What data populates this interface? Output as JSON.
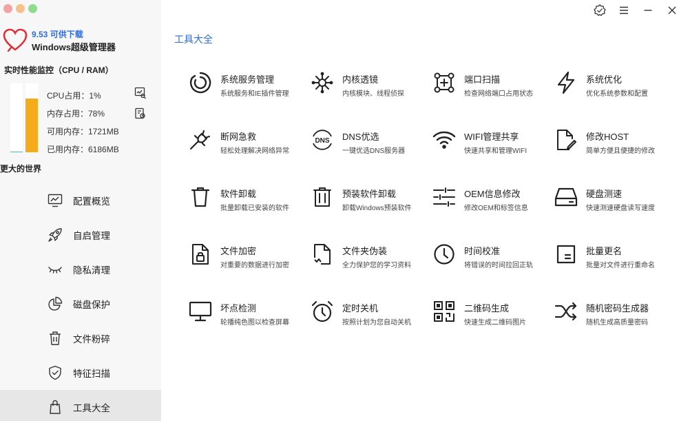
{
  "sidebar": {
    "update_text": "9.53 可供下载",
    "app_name": "Windows超级管理器",
    "monitor_title": "实时性能监控（CPU / RAM）",
    "cpu_usage_label": "CPU占用：1%",
    "mem_usage_label": "内存占用：78%",
    "available_mem_label": "可用内存：1721MB",
    "used_mem_label": "已用内存：6186MB",
    "cpu_percent": 1,
    "mem_percent": 78,
    "slogan": "更大的世界",
    "nav": [
      {
        "label": "配置概览",
        "icon": "monitor-chart-icon"
      },
      {
        "label": "自启管理",
        "icon": "rocket-icon"
      },
      {
        "label": "隐私清理",
        "icon": "eye-closed-icon"
      },
      {
        "label": "磁盘保护",
        "icon": "pie-chart-icon"
      },
      {
        "label": "文件粉碎",
        "icon": "trash-icon"
      },
      {
        "label": "特征扫描",
        "icon": "shield-check-icon"
      },
      {
        "label": "工具大全",
        "icon": "bag-icon",
        "active": true
      }
    ]
  },
  "main": {
    "title": "工具大全",
    "tools": [
      {
        "name": "系统服务管理",
        "desc": "系统服务和IE插件管理",
        "icon": "service-ring-icon"
      },
      {
        "name": "内核透镜",
        "desc": "内核模块、线程侦探",
        "icon": "virus-icon"
      },
      {
        "name": "端口扫描",
        "desc": "检查网络端口占用状态",
        "icon": "port-scan-icon"
      },
      {
        "name": "系统优化",
        "desc": "优化系统参数和配置",
        "icon": "lightning-icon"
      },
      {
        "name": "断网急救",
        "desc": "轻松处理解决网络异常",
        "icon": "plug-icon"
      },
      {
        "name": "DNS优选",
        "desc": "一键优选DNS服务器",
        "icon": "dns-icon"
      },
      {
        "name": "WIFI管理共享",
        "desc": "快速共享和管理WIFI",
        "icon": "wifi-icon"
      },
      {
        "name": "修改HOST",
        "desc": "简单方便且便捷的修改",
        "icon": "file-edit-icon"
      },
      {
        "name": "软件卸载",
        "desc": "批量卸载已安装的软件",
        "icon": "trash-can-icon"
      },
      {
        "name": "预装软件卸载",
        "desc": "卸载Windows预装软件",
        "icon": "trash-bin-icon"
      },
      {
        "name": "OEM信息修改",
        "desc": "修改OEM和标签信息",
        "icon": "sliders-icon"
      },
      {
        "name": "硬盘测速",
        "desc": "快速测速硬盘读写速度",
        "icon": "hard-drive-icon"
      },
      {
        "name": "文件加密",
        "desc": "对重要的数据进行加密",
        "icon": "file-lock-icon"
      },
      {
        "name": "文件夹伪装",
        "desc": "全力保护您的学习资料",
        "icon": "file-broken-icon"
      },
      {
        "name": "时间校准",
        "desc": "将错误的时间拉回正轨",
        "icon": "clock-icon"
      },
      {
        "name": "批量更名",
        "desc": "批量对文件进行重命名",
        "icon": "rename-icon"
      },
      {
        "name": "坏点检测",
        "desc": "轮播纯色图以检查屏幕",
        "icon": "monitor-icon"
      },
      {
        "name": "定时关机",
        "desc": "按照计划为您自动关机",
        "icon": "alarm-clock-icon"
      },
      {
        "name": "二维码生成",
        "desc": "快速生成二维码图片",
        "icon": "qrcode-icon"
      },
      {
        "name": "随机密码生成器",
        "desc": "随机生成高质量密码",
        "icon": "shuffle-icon"
      }
    ]
  },
  "colors": {
    "accent": "#2d6cdf",
    "cpu_bar": "#4ab8b8",
    "mem_bar": "#f5ab1b",
    "logo": "#e0303a"
  }
}
